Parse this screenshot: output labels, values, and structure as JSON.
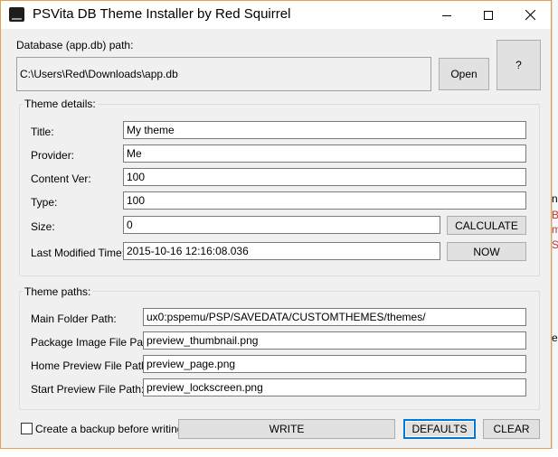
{
  "window": {
    "title": "PSVita DB Theme Installer by Red Squirrel"
  },
  "database": {
    "label": "Database (app.db) path:",
    "path": "C:\\Users\\Red\\Downloads\\app.db",
    "open_label": "Open",
    "help_label": "?"
  },
  "theme_details": {
    "title": "Theme details:",
    "title_label": "Title:",
    "title_value": "My theme",
    "provider_label": "Provider:",
    "provider_value": "Me",
    "content_ver_label": "Content Ver:",
    "content_ver_value": "100",
    "type_label": "Type:",
    "type_value": "100",
    "size_label": "Size:",
    "size_value": "0",
    "calculate_label": "CALCULATE",
    "last_modified_label": "Last Modified Time:",
    "last_modified_value": "2015-10-16 12:16:08.036",
    "now_label": "NOW"
  },
  "theme_paths": {
    "title": "Theme paths:",
    "main_folder_label": "Main Folder Path:",
    "main_folder_value": "ux0:pspemu/PSP/SAVEDATA/CUSTOMTHEMES/themes/",
    "package_image_label": "Package Image File Path:",
    "package_image_value": "preview_thumbnail.png",
    "home_preview_label": "Home Preview File Path:",
    "home_preview_value": "preview_page.png",
    "start_preview_label": "Start Preview File Path:",
    "start_preview_value": "preview_lockscreen.png"
  },
  "footer": {
    "backup_label": "Create a backup before writing",
    "write_label": "WRITE",
    "defaults_label": "DEFAULTS",
    "clear_label": "CLEAR"
  },
  "background": {
    "fragments": [
      "na",
      "B",
      "m",
      "S",
      "e"
    ]
  },
  "colors": {
    "accent": "#0078d7",
    "window_border": "#e2a24a",
    "face": "#f0f0f0"
  }
}
